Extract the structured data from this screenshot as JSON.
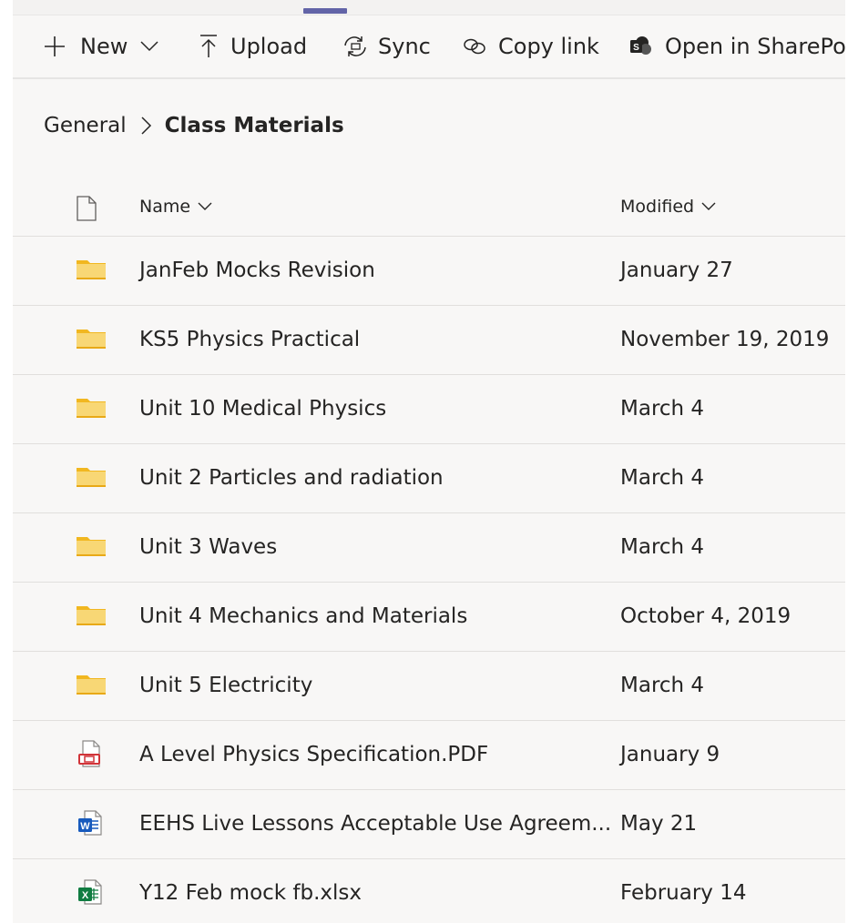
{
  "toolbar": {
    "new_label": "New",
    "upload_label": "Upload",
    "sync_label": "Sync",
    "copy_link_label": "Copy link",
    "open_sharepoint_label": "Open in SharePoir"
  },
  "breadcrumb": {
    "root": "General",
    "current": "Class Materials"
  },
  "columns": {
    "name": "Name",
    "modified": "Modified"
  },
  "files": [
    {
      "name": "JanFeb Mocks Revision",
      "modified": "January 27",
      "type": "folder-icon"
    },
    {
      "name": "KS5 Physics Practical",
      "modified": "November 19, 2019",
      "type": "folder-icon"
    },
    {
      "name": "Unit 10 Medical Physics",
      "modified": "March 4",
      "type": "folder-icon"
    },
    {
      "name": "Unit 2 Particles and radiation",
      "modified": "March 4",
      "type": "folder-icon"
    },
    {
      "name": "Unit 3 Waves",
      "modified": "March 4",
      "type": "folder-icon"
    },
    {
      "name": "Unit 4 Mechanics and Materials",
      "modified": "October 4, 2019",
      "type": "folder-icon"
    },
    {
      "name": "Unit 5 Electricity",
      "modified": "March 4",
      "type": "folder-icon"
    },
    {
      "name": "A Level Physics Specification.PDF",
      "modified": "January 9",
      "type": "pdf-file-icon"
    },
    {
      "name": "EEHS Live Lessons Acceptable Use Agreem...",
      "modified": "May 21",
      "type": "word-file-icon"
    },
    {
      "name": "Y12 Feb mock fb.xlsx",
      "modified": "February 14",
      "type": "excel-file-icon"
    }
  ],
  "colors": {
    "accent": "#6264a7",
    "folder": "#f8d775",
    "pdf": "#d13438",
    "word": "#185abd",
    "excel": "#107c41"
  }
}
